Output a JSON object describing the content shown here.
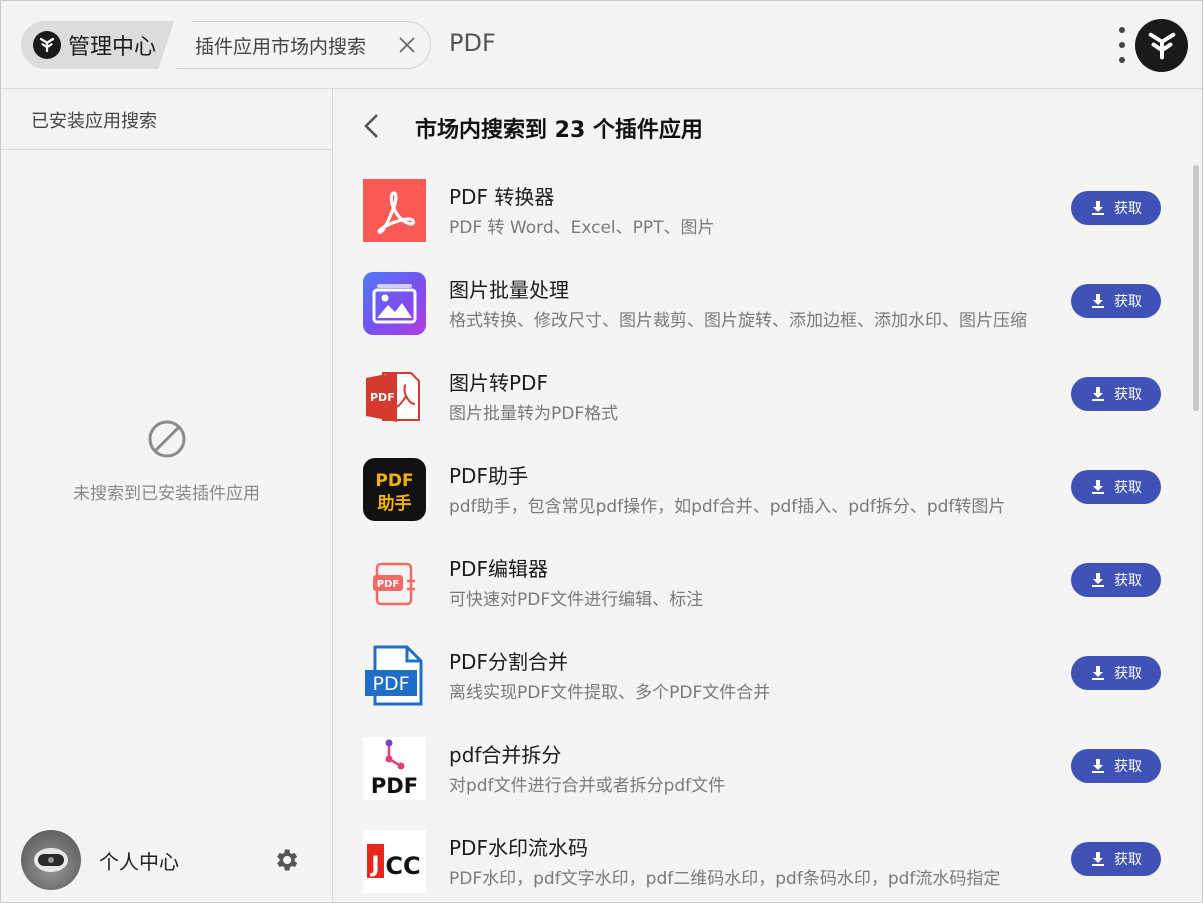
{
  "topbar": {
    "home_label": "管理中心",
    "search_tab_label": "插件应用市场内搜索",
    "query": "PDF"
  },
  "sidebar": {
    "search_label": "已安装应用搜索",
    "empty_text": "未搜索到已安装插件应用",
    "user_label": "个人中心"
  },
  "main": {
    "result_title": "市场内搜索到 23 个插件应用",
    "get_label": "获取",
    "apps": [
      {
        "name": "PDF 转换器",
        "desc": "PDF 转 Word、Excel、PPT、图片",
        "icon": "pdf-converter-icon"
      },
      {
        "name": "图片批量处理",
        "desc": "格式转换、修改尺寸、图片裁剪、图片旋转、添加边框、添加水印、图片压缩",
        "icon": "image-batch-icon"
      },
      {
        "name": "图片转PDF",
        "desc": "图片批量转为PDF格式",
        "icon": "image-to-pdf-icon"
      },
      {
        "name": "PDF助手",
        "desc": "pdf助手，包含常见pdf操作，如pdf合并、pdf插入、pdf拆分、pdf转图片",
        "icon": "pdf-helper-icon",
        "icon_text_top": "PDF",
        "icon_text_bottom": "助手"
      },
      {
        "name": "PDF编辑器",
        "desc": "可快速对PDF文件进行编辑、标注",
        "icon": "pdf-editor-icon",
        "icon_text": "PDF"
      },
      {
        "name": "PDF分割合并",
        "desc": "离线实现PDF文件提取、多个PDF文件合并",
        "icon": "pdf-split-merge-icon",
        "icon_text": "PDF"
      },
      {
        "name": "pdf合并拆分",
        "desc": "对pdf文件进行合并或者拆分pdf文件",
        "icon": "pdf-merge-split-icon",
        "icon_text": "PDF"
      },
      {
        "name": "PDF水印流水码",
        "desc": "PDF水印，pdf文字水印，pdf二维码水印，pdf条码水印，pdf流水码指定",
        "icon": "pdf-watermark-icon",
        "icon_text_a": "J",
        "icon_text_b": "CC"
      }
    ]
  },
  "colors": {
    "accent": "#3f52b5",
    "background": "#f4f4f4",
    "pdf_red": "#fa5a56"
  }
}
